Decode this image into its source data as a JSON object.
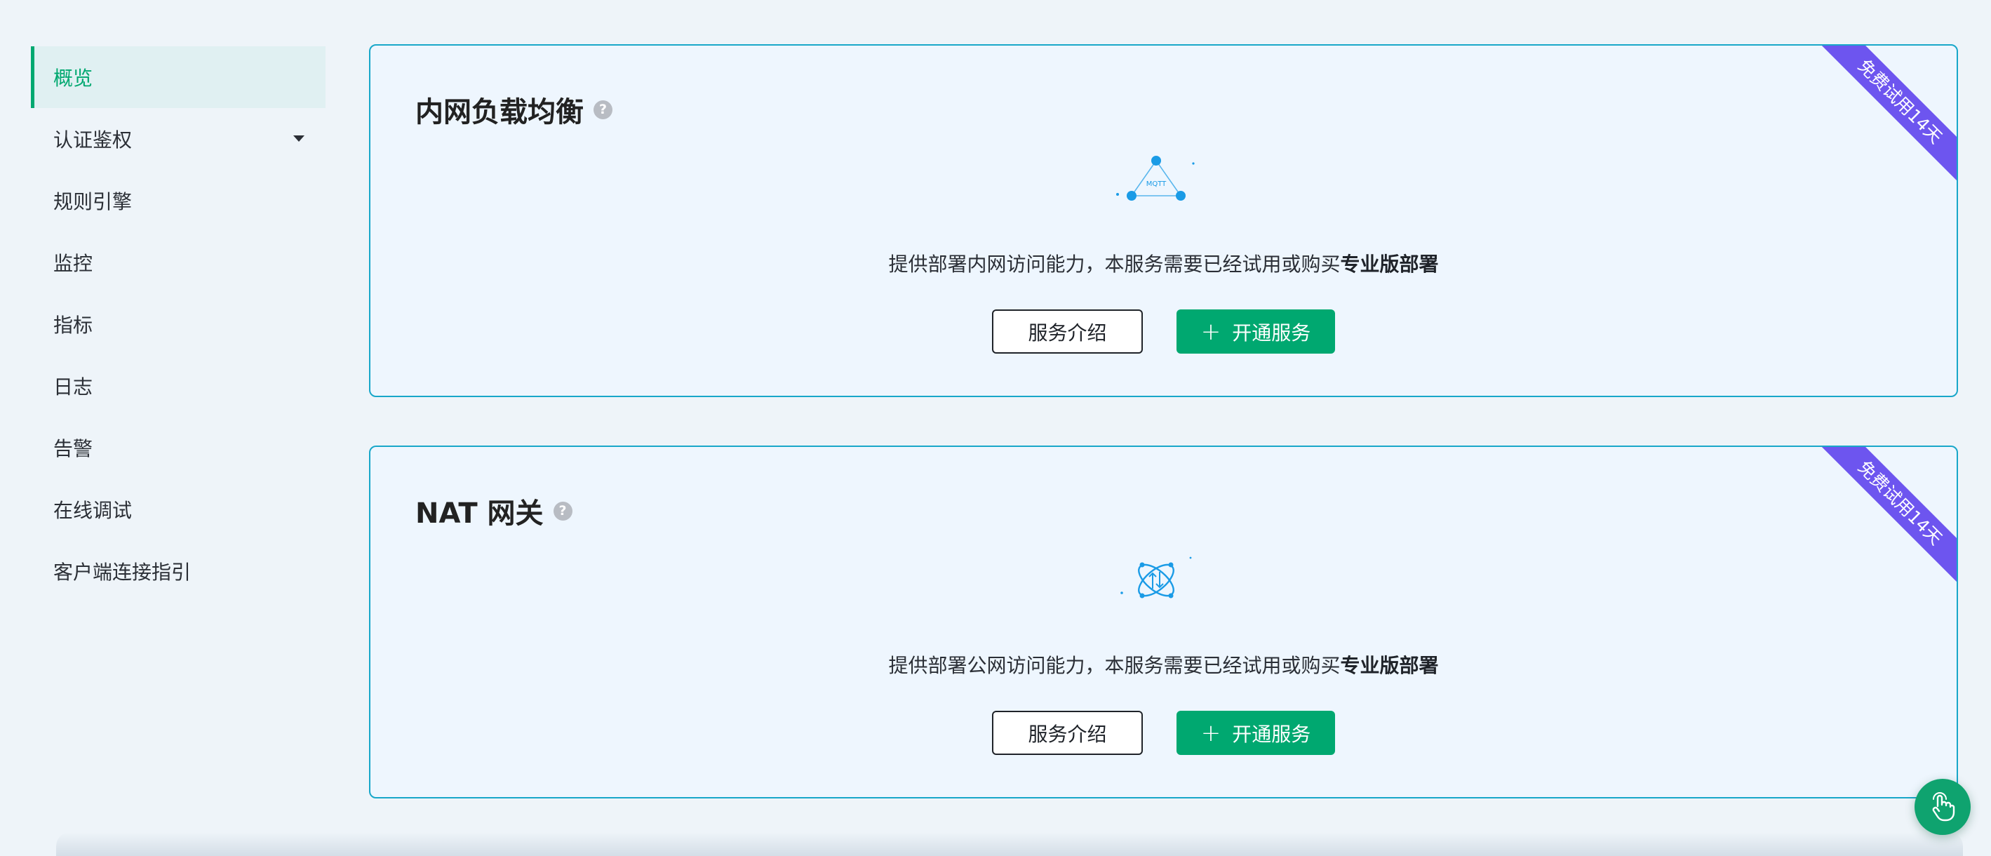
{
  "sidebar": {
    "items": [
      {
        "label": "概览",
        "active": true
      },
      {
        "label": "认证鉴权",
        "has_submenu": true
      },
      {
        "label": "规则引擎"
      },
      {
        "label": "监控"
      },
      {
        "label": "指标"
      },
      {
        "label": "日志"
      },
      {
        "label": "告警"
      },
      {
        "label": "在线调试"
      },
      {
        "label": "客户端连接指引"
      }
    ]
  },
  "cards": [
    {
      "title": "内网负载均衡",
      "ribbon": "免费试用14天",
      "illustration": "mqtt-network-icon",
      "illustration_text": "MQTT",
      "description_prefix": "提供部署内网访问能力，本服务需要已经试用或购买",
      "description_bold": "专业版部署",
      "intro_button": "服务介绍",
      "enable_button": "开通服务"
    },
    {
      "title": "NAT 网关",
      "ribbon": "免费试用14天",
      "illustration": "nat-gateway-icon",
      "description_prefix": "提供部署公网访问能力，本服务需要已经试用或购买",
      "description_bold": "专业版部署",
      "intro_button": "服务介绍",
      "enable_button": "开通服务"
    }
  ],
  "help_icon": "?",
  "colors": {
    "accent": "#00a870",
    "card_border": "#18a7c9",
    "ribbon": "#6d55ef",
    "background": "#eef4f9"
  },
  "floating_button": {
    "icon": "hand-pointer-icon"
  }
}
